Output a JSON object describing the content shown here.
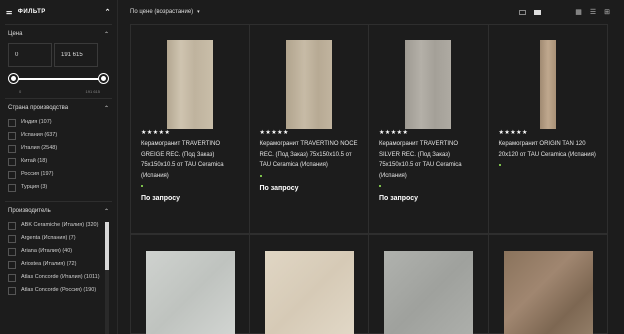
{
  "filter": {
    "title": "ФИЛЬТР"
  },
  "price": {
    "title": "Цена",
    "min_value": "0",
    "max_value": "191 615",
    "slider_min_label": "0",
    "slider_max_label": "191 615"
  },
  "country": {
    "title": "Страна производства",
    "items": [
      "Индия (107)",
      "Испания (637)",
      "Италия (2548)",
      "Китай (18)",
      "Россия (197)",
      "Турция (3)"
    ]
  },
  "manufacturer": {
    "title": "Производитель",
    "items": [
      "ABK Ceramiche (Италия) (320)",
      "Argenta (Испания) (7)",
      "Ariana (Италия) (40)",
      "Ariostea (Италия) (72)",
      "Atlas Concorde (Италия) (1011)",
      "Atlas Concorde (Россия) (190)"
    ]
  },
  "sort": {
    "label": "По цене (возрастание)"
  },
  "products": [
    {
      "stars": "★★★★★",
      "title": "Керамогранит TRAVERTINO GREIGE REC. (Под Заказ) 75x150x10.5 от TAU Ceramica (Испания)",
      "price": "По запросу",
      "color": "#c2b7a4"
    },
    {
      "stars": "★★★★★",
      "title": "Керамогранит TRAVERTINO NOCE REC. (Под Заказ) 75x150x10.5 от TAU Ceramica (Испания)",
      "price": "По запросу",
      "color": "#bbae98"
    },
    {
      "stars": "★★★★★",
      "title": "Керамогранит TRAVERTINO SILVER REC. (Под Заказ) 75x150x10.5 от TAU Ceramica (Испания)",
      "price": "По запросу",
      "color": "#a9a59d"
    },
    {
      "stars": "★★★★★",
      "title": "Керамогранит ORIGIN TAN 120 20x120 от TAU Ceramica (Испания)",
      "price": "",
      "color": "#b69f86"
    }
  ],
  "products_row2": [
    {
      "color": "#c9ccc9"
    },
    {
      "color": "#ddd2c0"
    },
    {
      "color": "#a9aba7"
    },
    {
      "color": "#8c7660"
    }
  ]
}
